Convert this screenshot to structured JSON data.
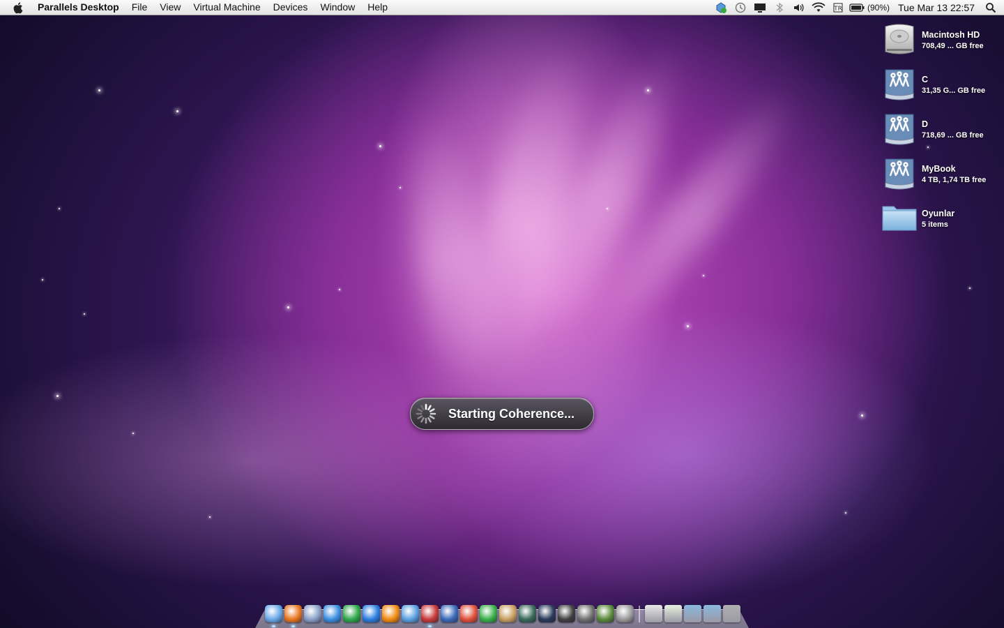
{
  "menubar": {
    "apple_icon": "apple-icon",
    "app_name": "Parallels Desktop",
    "menus": [
      "File",
      "View",
      "Virtual Machine",
      "Devices",
      "Window",
      "Help"
    ],
    "status_icons": [
      "parallels-status-icon",
      "time-machine-icon",
      "display-icon",
      "bluetooth-icon",
      "volume-icon",
      "wifi-icon",
      "input-menu-icon",
      "battery-icon"
    ],
    "battery_percent": "(90%)",
    "clock": "Tue Mar 13  22:57",
    "spotlight_icon": "spotlight-search-icon"
  },
  "desktop_items": [
    {
      "name": "Macintosh HD",
      "info": "708,49 ... GB free",
      "icon": "hard-drive-icon"
    },
    {
      "name": "C",
      "info": "31,35 G... GB free",
      "icon": "network-share-icon"
    },
    {
      "name": "D",
      "info": "718,69 ... GB free",
      "icon": "network-share-icon"
    },
    {
      "name": "MyBook",
      "info": "4 TB, 1,74 TB free",
      "icon": "network-share-icon"
    },
    {
      "name": "Oyunlar",
      "info": "5 items",
      "icon": "folder-icon"
    }
  ],
  "hud": {
    "text": "Starting Coherence...",
    "icon": "spinner-icon"
  },
  "dock": {
    "apps": [
      {
        "name": "finder-icon",
        "color": "#6aa8e8",
        "running": true
      },
      {
        "name": "firefox-icon",
        "color": "#e8761e",
        "running": true
      },
      {
        "name": "preview-icon",
        "color": "#8aa0c8",
        "running": false
      },
      {
        "name": "itunes-icon",
        "color": "#3a8ee0",
        "running": false
      },
      {
        "name": "crossover-icon",
        "color": "#2ea84a",
        "running": false
      },
      {
        "name": "app-store-icon",
        "color": "#2a7ee0",
        "running": false
      },
      {
        "name": "vlc-icon",
        "color": "#f08a10",
        "running": false
      },
      {
        "name": "quicktime-icon",
        "color": "#5aa0e0",
        "running": false
      },
      {
        "name": "parallels-icon",
        "color": "#c83a3a",
        "running": true
      },
      {
        "name": "media-player-icon",
        "color": "#3a6ab8",
        "running": false
      },
      {
        "name": "coconut-icon",
        "color": "#e0503a",
        "running": false
      },
      {
        "name": "minecraft-launcher-icon",
        "color": "#3ab04a",
        "running": false
      },
      {
        "name": "game-app-icon",
        "color": "#c8a060",
        "running": false
      },
      {
        "name": "triangle-app-icon",
        "color": "#3a6a5a",
        "running": false
      },
      {
        "name": "dark-game-icon",
        "color": "#2a3a5a",
        "running": false
      },
      {
        "name": "steam-icon",
        "color": "#404040",
        "running": false
      },
      {
        "name": "gun-game-icon",
        "color": "#707070",
        "running": false
      },
      {
        "name": "minecraft-icon",
        "color": "#5a8a3a",
        "running": false
      },
      {
        "name": "system-preferences-icon",
        "color": "#9a9a9a",
        "running": false
      }
    ],
    "docs": [
      {
        "name": "document-stack-icon",
        "color": "#e8e8e8"
      },
      {
        "name": "downloads-stack-icon",
        "color": "#e8f0e0"
      },
      {
        "name": "applications-folder-icon",
        "color": "#8ab8e0"
      },
      {
        "name": "documents-folder-icon",
        "color": "#8ab8e0"
      },
      {
        "name": "trash-icon",
        "color": "#b0b0b0"
      }
    ]
  }
}
